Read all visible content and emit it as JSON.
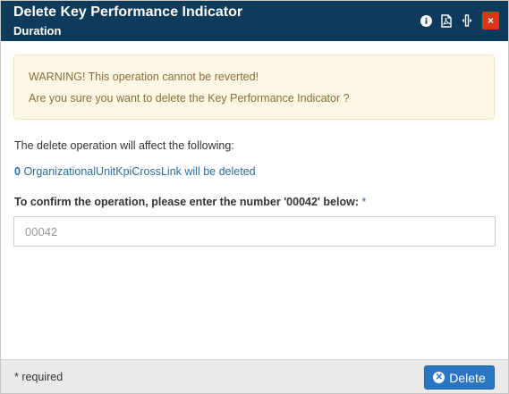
{
  "header": {
    "title": "Delete Key Performance Indicator",
    "subtitle": "Duration",
    "tools": [
      "info-icon",
      "pdf-icon",
      "resize-icon"
    ],
    "close_label": "×"
  },
  "warning": {
    "line1": "WARNING! This operation cannot be reverted!",
    "line2": "Are you sure you want to delete the Key Performance Indicator ?"
  },
  "affect": {
    "text": "The delete operation will affect the following:",
    "items": [
      {
        "count": "0",
        "label": "OrganizationalUnitKpiCrossLink will be deleted"
      }
    ]
  },
  "confirm": {
    "label": "To confirm the operation, please enter the number '00042' below:",
    "required_marker": "*",
    "value": "",
    "placeholder": "00042"
  },
  "footer": {
    "required_note": "* required",
    "delete_label": "Delete"
  },
  "colors": {
    "header_bg": "#0e3a5c",
    "close_bg": "#d9361b",
    "warning_bg": "#fcf8e3",
    "warning_text": "#8a6d3b",
    "link": "#2a6e9e",
    "primary_button": "#2a76c2"
  }
}
